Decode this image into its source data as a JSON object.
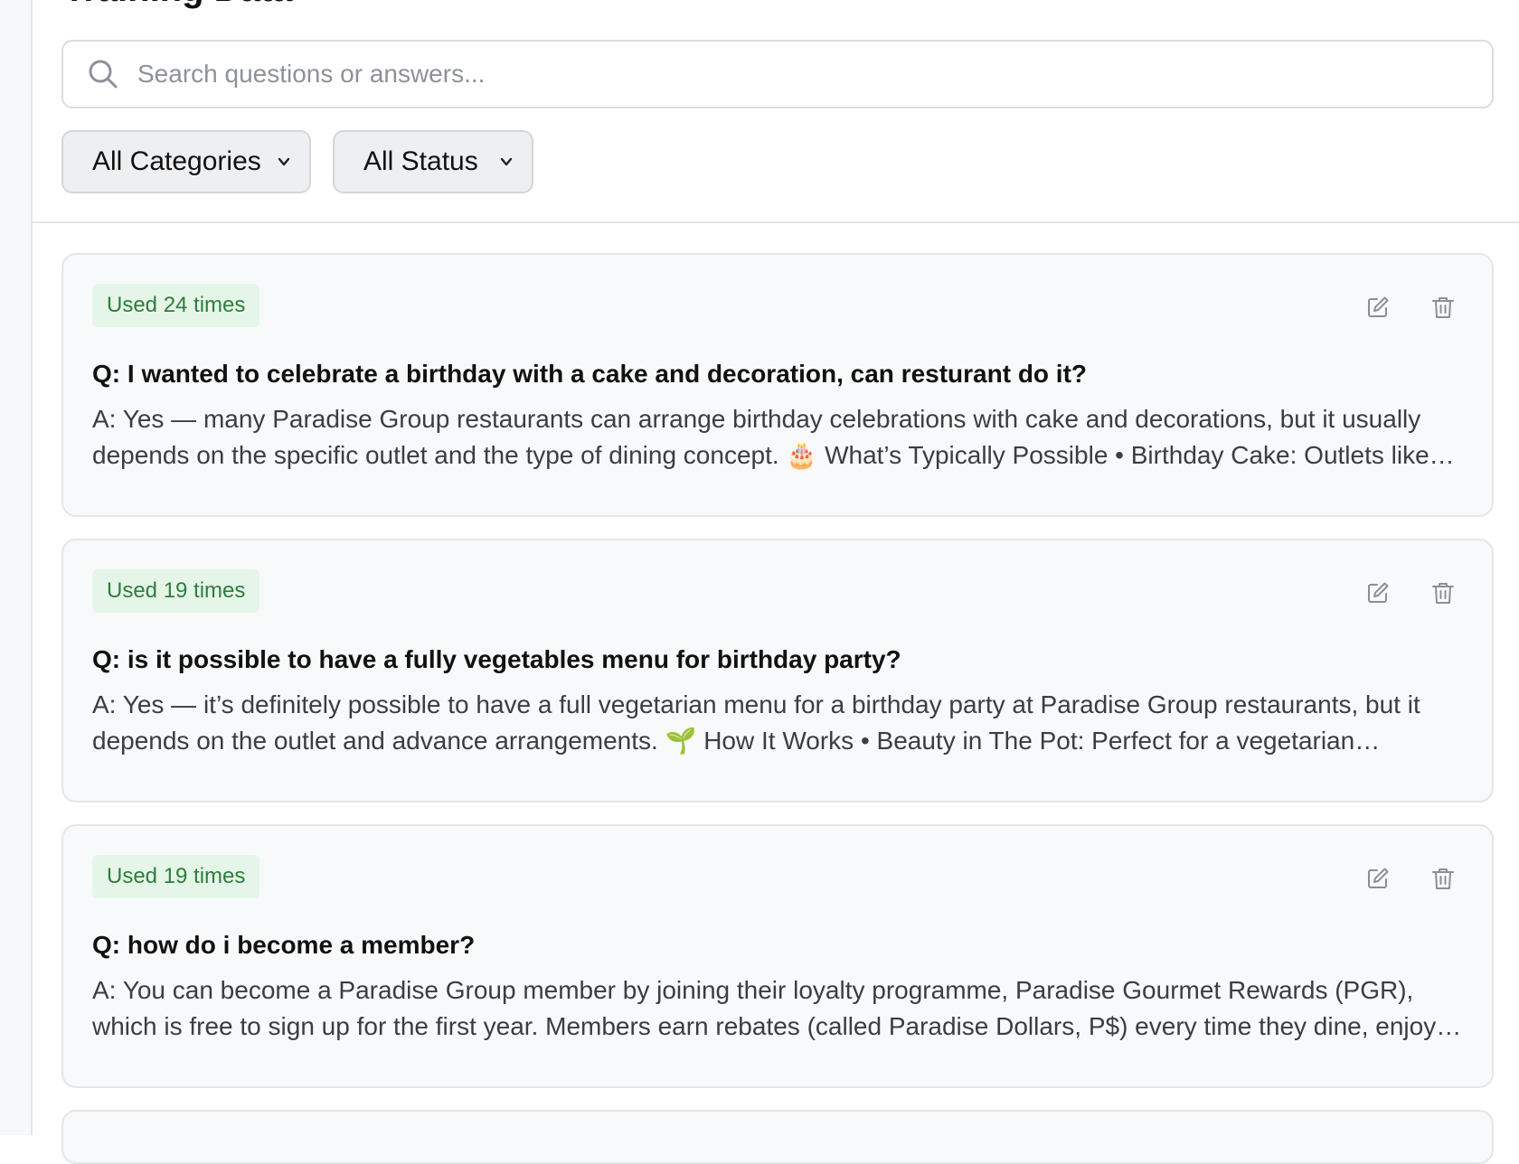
{
  "page": {
    "title": "Training Data"
  },
  "search": {
    "placeholder": "Search questions or answers...",
    "value": ""
  },
  "filters": {
    "category": {
      "selected": "All Categories"
    },
    "status": {
      "selected": "All Status"
    }
  },
  "items": [
    {
      "usage": "Used 24 times",
      "question": "Q: I wanted to celebrate a birthday with a cake and decoration, can resturant do it?",
      "answer": "A: Yes — many Paradise Group restaurants can arrange birthday celebrations with cake and decorations, but it usually depends on the specific outlet and the type of dining concept. 🎂 What’s Typically Possible • Birthday Cake: Outlets like…"
    },
    {
      "usage": "Used 19 times",
      "question": "Q: is it possible to have a fully vegetables menu for birthday party?",
      "answer": "A: Yes — it’s definitely possible to have a full vegetarian menu for a birthday party at Paradise Group restaurants, but it depends on the outlet and advance arrangements. 🌱 How It Works • Beauty in The Pot: Perfect for a vegetarian celebratio…"
    },
    {
      "usage": "Used 19 times",
      "question": "Q: how do i become a member?",
      "answer": "A: You can become a Paradise Group member by joining their loyalty programme, Paradise Gourmet Rewards (PGR), which is free to sign up for the first year. Members earn rebates (called Paradise Dollars, P$) every time they dine, enjoy birthday…"
    }
  ],
  "icons": {
    "search": "search-icon",
    "dropdown": "chevron-down-icon",
    "edit": "edit-icon",
    "delete": "trash-icon"
  },
  "colors": {
    "badge_bg": "#e5f6e8",
    "badge_text": "#2e7d3d",
    "card_bg": "#f8f9fa",
    "border": "#e4e6ea"
  }
}
